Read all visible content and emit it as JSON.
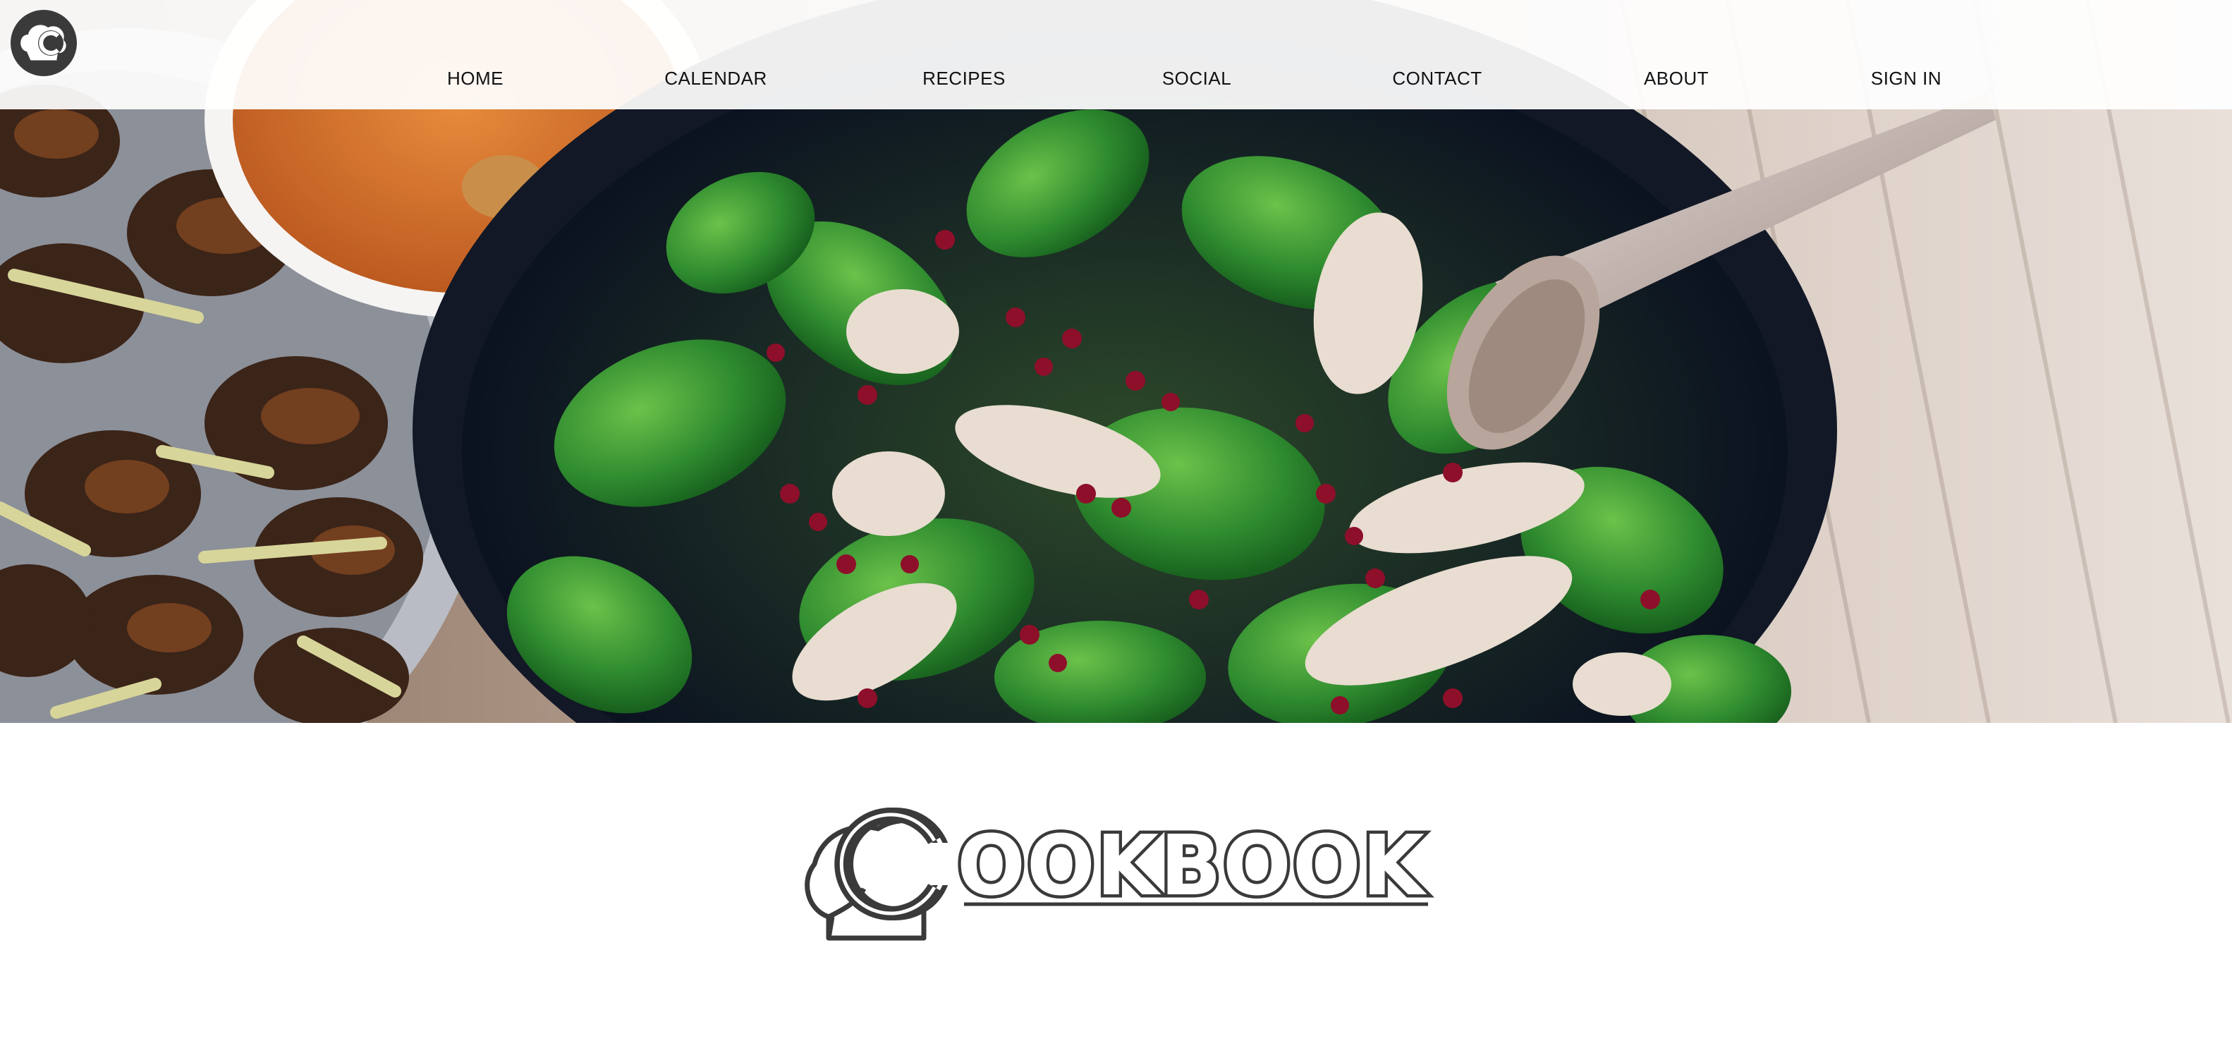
{
  "nav": {
    "logo_icon": "chef-hat-c-logo-icon",
    "links": [
      {
        "label": "HOME"
      },
      {
        "label": "CALENDAR"
      },
      {
        "label": "RECIPES"
      },
      {
        "label": "SOCIAL"
      },
      {
        "label": "CONTACT"
      },
      {
        "label": "ABOUT"
      },
      {
        "label": "SIGN IN"
      }
    ]
  },
  "hero": {
    "image": "salad-bowl-hero-photo"
  },
  "brand": {
    "logo_icon": "chef-hat-c-logo-icon",
    "wordmark": "OOKBOOK"
  },
  "colors": {
    "nav_bg": "#ffffff",
    "nav_text": "#111111",
    "logo_dark": "#3a3a3a",
    "page_bg": "#ffffff"
  }
}
